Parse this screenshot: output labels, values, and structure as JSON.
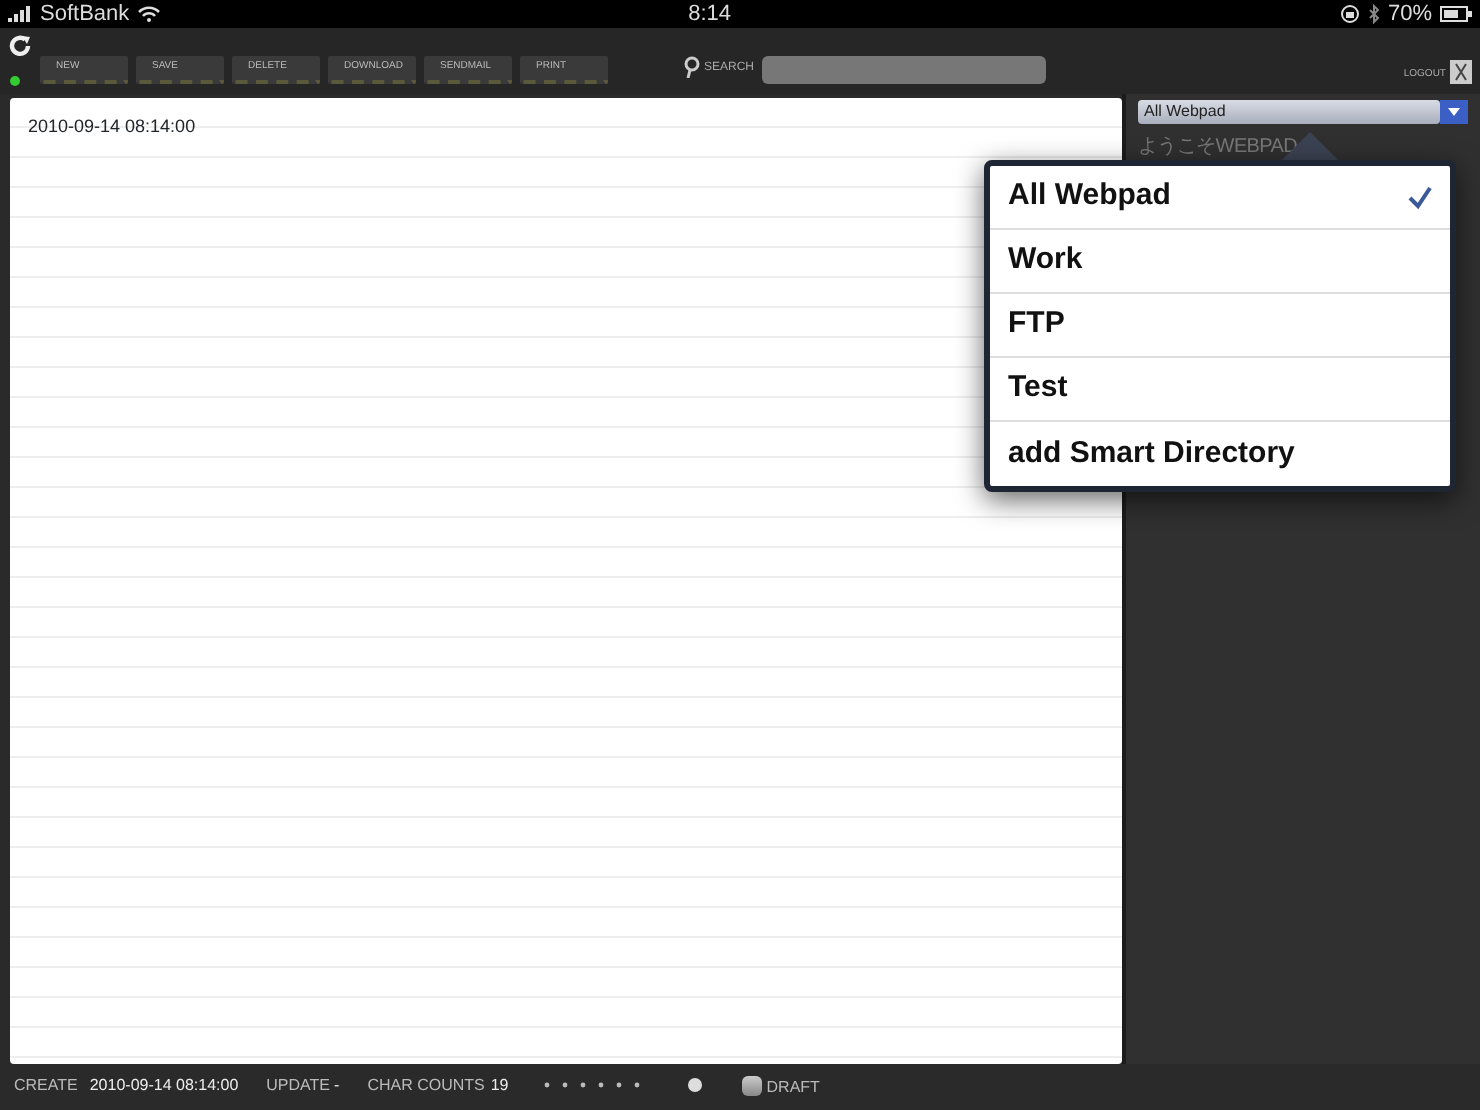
{
  "status_bar": {
    "carrier": "SoftBank",
    "time": "8:14",
    "battery": "70%"
  },
  "toolbar": {
    "buttons": [
      "NEW",
      "SAVE",
      "DELETE",
      "DOWNLOAD",
      "SENDMAIL",
      "PRINT"
    ],
    "search_label": "SEARCH",
    "logout": "LOGOUT"
  },
  "editor": {
    "text": "2010-09-14 08:14:00"
  },
  "sidebar": {
    "directory": "All Webpad",
    "welcome": "ようこそWEBPAD"
  },
  "popover": {
    "items": [
      {
        "label": "All Webpad",
        "selected": true
      },
      {
        "label": "Work",
        "selected": false
      },
      {
        "label": "FTP",
        "selected": false
      },
      {
        "label": "Test",
        "selected": false
      },
      {
        "label": "add Smart Directory",
        "selected": false
      }
    ]
  },
  "footer": {
    "create_label": "CREATE",
    "create_value": "2010-09-14 08:14:00",
    "update_label": "UPDATE",
    "update_value": "-",
    "count_label": "CHAR COUNTS",
    "count_value": "19",
    "draft_label": "DRAFT",
    "draft": false
  }
}
